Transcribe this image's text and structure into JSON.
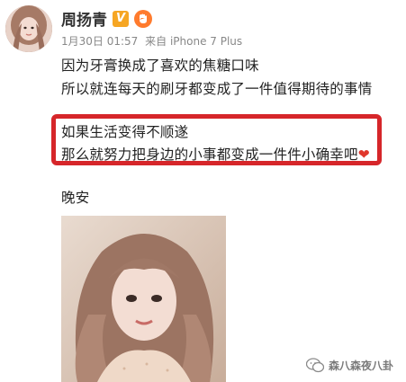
{
  "user": {
    "name": "周扬青",
    "vip_badge": "V"
  },
  "post": {
    "meta_date": "1月30日 01:57",
    "meta_source": "来自 iPhone 7 Plus",
    "line1": "因为牙膏换成了喜欢的焦糖口味",
    "line2": "所以就连每天的刷牙都变成了一件值得期待的事情",
    "highlight_line1": "如果生活变得不顺遂",
    "highlight_line2": "那么就努力把身边的小事都变成一件件小确幸吧",
    "heart_emoji": "❤",
    "line3": "晚安"
  },
  "watermark": {
    "label": "森八森夜八卦"
  },
  "colors": {
    "highlight_border": "#d6262a",
    "badge_vip": "#f6a623",
    "badge_level": "#ff7b2d",
    "meta_text": "#888888"
  }
}
